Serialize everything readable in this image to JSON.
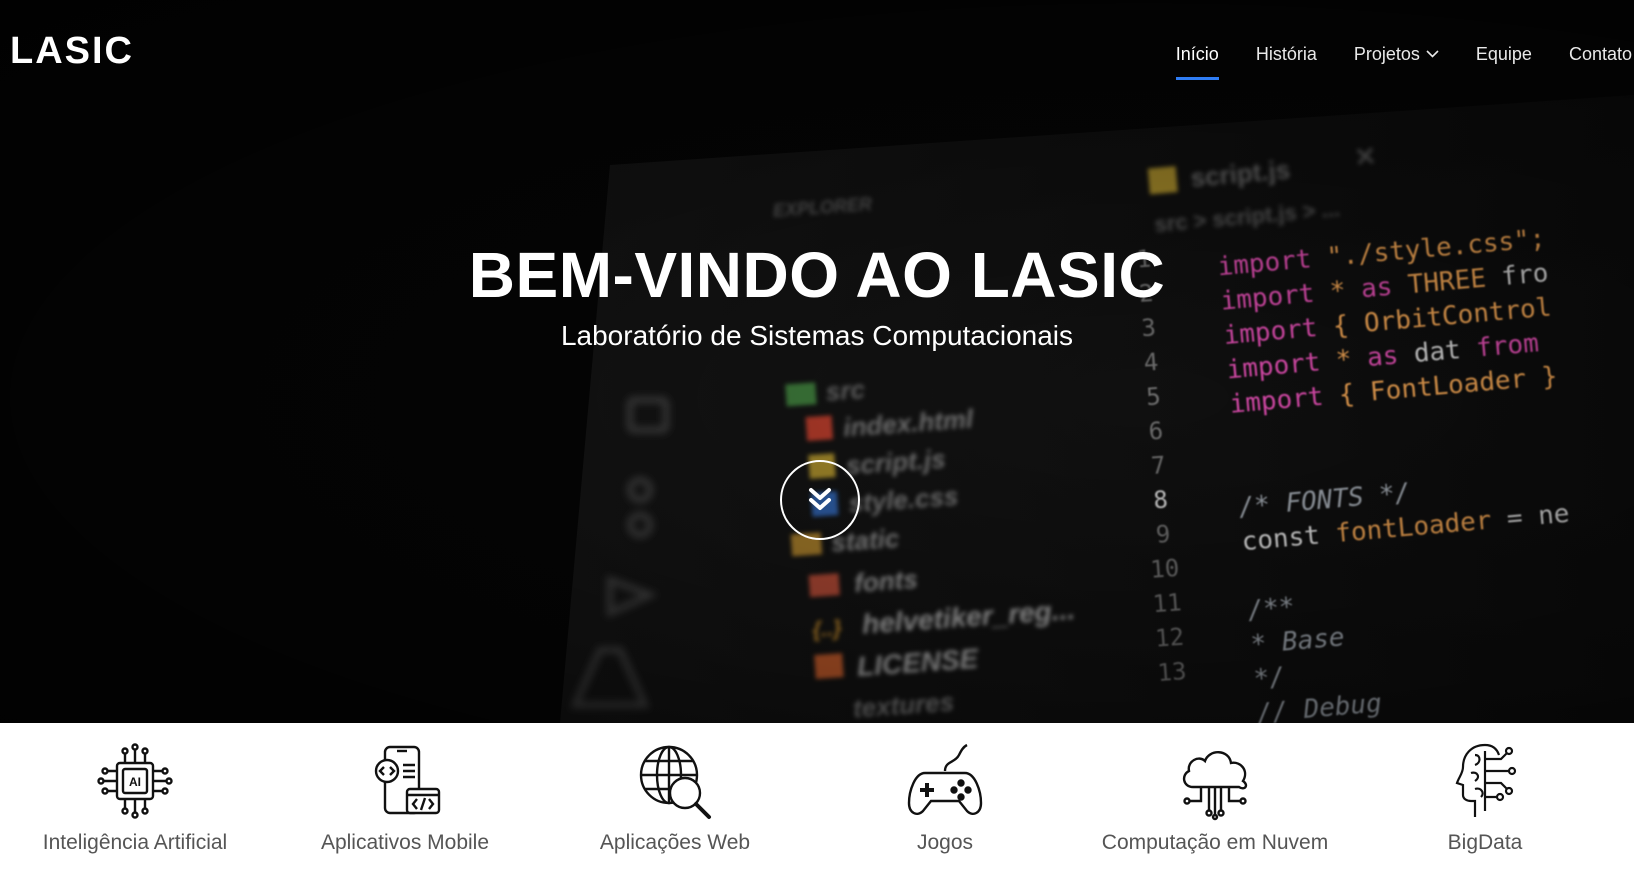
{
  "nav": {
    "brand": "LASIC",
    "items": [
      {
        "label": "Início",
        "active": true
      },
      {
        "label": "História"
      },
      {
        "label": "Projetos",
        "has_dropdown": true
      },
      {
        "label": "Equipe"
      },
      {
        "label": "Contato"
      }
    ]
  },
  "hero": {
    "title": "BEM-VINDO AO LASIC",
    "subtitle": "Laboratório de Sistemas Computacionais",
    "scroll_icon": "chevron-double-down-icon"
  },
  "background_code": {
    "tab": "script.js",
    "breadcrumb": "src > script.js > ...",
    "explorer": [
      "src",
      "index.html",
      "script.js",
      "style.css",
      "static",
      "fonts",
      "helvetiker_reg...",
      "LICENSE",
      "textures"
    ],
    "line_numbers": [
      "1",
      "2",
      "3",
      "4",
      "5",
      "6",
      "7",
      "8",
      "9",
      "10",
      "11",
      "12",
      "13"
    ],
    "code_lines": [
      "import \"./style.css\";",
      "import * as THREE fro",
      "import { OrbitControl",
      "import * as dat from",
      "import { FontLoader }",
      "",
      "",
      "/* FONTS */",
      "const fontLoader = ne",
      "",
      "/**",
      " * Base",
      " */"
    ],
    "trailing_line": "// Debug"
  },
  "services": [
    {
      "label": "Inteligência Artificial",
      "icon": "ai-chip-icon"
    },
    {
      "label": "Aplicativos Mobile",
      "icon": "mobile-app-icon"
    },
    {
      "label": "Aplicações Web",
      "icon": "web-globe-icon"
    },
    {
      "label": "Jogos",
      "icon": "gamepad-icon"
    },
    {
      "label": "Computação em Nuvem",
      "icon": "cloud-icon"
    },
    {
      "label": "BigData",
      "icon": "brain-data-icon"
    }
  ],
  "colors": {
    "accent": "#2f7df5",
    "code_keyword": "#d54aa8",
    "code_string": "#e29a4e",
    "code_comment": "#9aa0a8"
  }
}
